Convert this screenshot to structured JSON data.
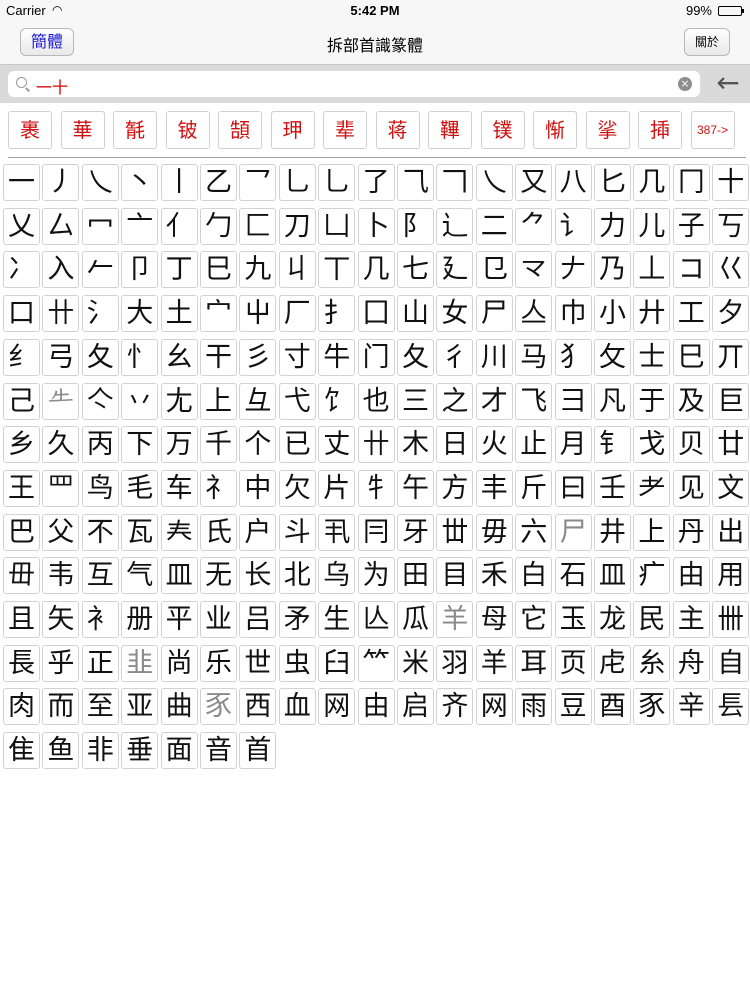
{
  "status": {
    "carrier": "Carrier",
    "wifi_icon": "wifi-icon",
    "time": "5:42 PM",
    "battery": "99%"
  },
  "nav": {
    "title": "拆部首識篆體",
    "left_button": "簡體",
    "right_button": "關於"
  },
  "search": {
    "value": "一十",
    "clear_icon": "⊗",
    "back_icon": "←"
  },
  "suggestions": [
    "裹",
    "華",
    "毻",
    "铍",
    "頶",
    "玾",
    "辈",
    "蒋",
    "鞸",
    "镤",
    "惭",
    "挲",
    "揷",
    "387->"
  ],
  "radicals": [
    [
      "一",
      "丿",
      "乀",
      "丶",
      "丨",
      "乙",
      "乛",
      "乚",
      "乚",
      "了",
      "⺄",
      "𠃍",
      "乀",
      "又",
      "八",
      "匕",
      "几",
      "冂",
      "十"
    ],
    [
      "乂",
      "厶",
      "冖",
      "亠",
      "亻",
      "勹",
      "匚",
      "刀",
      "凵",
      "卜",
      "阝",
      "辶",
      "二",
      "⺈",
      "讠",
      "力",
      "儿",
      "子",
      "丂"
    ],
    [
      "冫",
      "入",
      "𠂉",
      "卩",
      "丁",
      "巳",
      "九",
      "丩",
      "丅",
      "几",
      "七",
      "廴",
      "⺋",
      "龴",
      "𠂇",
      "乃",
      "丄",
      "コ",
      "巜"
    ],
    [
      "口",
      "卄",
      "氵",
      "大",
      "土",
      "宀",
      "屮",
      "厂",
      "扌",
      "囗",
      "山",
      "女",
      "尸",
      "亼",
      "巾",
      "小",
      "廾",
      "工",
      "夕"
    ],
    [
      "纟",
      "弓",
      "夂",
      "忄",
      "幺",
      "干",
      "彡",
      "寸",
      "牛",
      "门",
      "夂",
      "彳",
      "川",
      "马",
      "犭",
      "攵",
      "士",
      "巳",
      "丌"
    ],
    [
      "己",
      "𠂒",
      "亽",
      "丷",
      "尢",
      "上",
      "彑",
      "弋",
      "饣",
      "也",
      "三",
      "之",
      "才",
      "飞",
      "彐",
      "凡",
      "于",
      "及",
      "巨"
    ],
    [
      "乡",
      "久",
      "丙",
      "下",
      "万",
      "千",
      "个",
      "已",
      "丈",
      "卄",
      "木",
      "日",
      "火",
      "止",
      "月",
      "钅",
      "戈",
      "贝",
      "廿"
    ],
    [
      "王",
      "罒",
      "鸟",
      "毛",
      "车",
      "礻",
      "中",
      "欠",
      "片",
      "牜",
      "午",
      "方",
      "丰",
      "斤",
      "曰",
      "壬",
      "耂",
      "见",
      "文"
    ],
    [
      "巴",
      "父",
      "不",
      "瓦",
      "𡗗",
      "氏",
      "户",
      "斗",
      "丮",
      "冃",
      "牙",
      "丗",
      "毋",
      "六",
      "尸",
      "井",
      "上",
      "丹",
      "出"
    ],
    [
      "毌",
      "韦",
      "互",
      "气",
      "皿",
      "无",
      "长",
      "北",
      "乌",
      "为",
      "田",
      "目",
      "禾",
      "白",
      "石",
      "皿",
      "疒",
      "由",
      "用"
    ],
    [
      "且",
      "矢",
      "衤",
      "册",
      "平",
      "业",
      "吕",
      "矛",
      "生",
      "亾",
      "瓜",
      "羊",
      "母",
      "它",
      "玉",
      "龙",
      "民",
      "主",
      "卌"
    ],
    [
      "長",
      "乎",
      "正",
      "韭",
      "尚",
      "乐",
      "世",
      "虫",
      "臼",
      "𥫗",
      "米",
      "羽",
      "羊",
      "耳",
      "页",
      "虍",
      "糸",
      "舟",
      "自"
    ],
    [
      "肉",
      "而",
      "至",
      "亚",
      "曲",
      "豕",
      "西",
      "血",
      "网",
      "由",
      "启",
      "齐",
      "网",
      "雨",
      "豆",
      "酉",
      "豕",
      "辛",
      "镸"
    ],
    [
      "隹",
      "鱼",
      "非",
      "垂",
      "面",
      "音",
      "首"
    ]
  ],
  "gray_cells": [
    [
      5,
      1
    ],
    [
      8,
      14
    ],
    [
      10,
      11
    ],
    [
      11,
      3
    ],
    [
      12,
      5
    ]
  ]
}
